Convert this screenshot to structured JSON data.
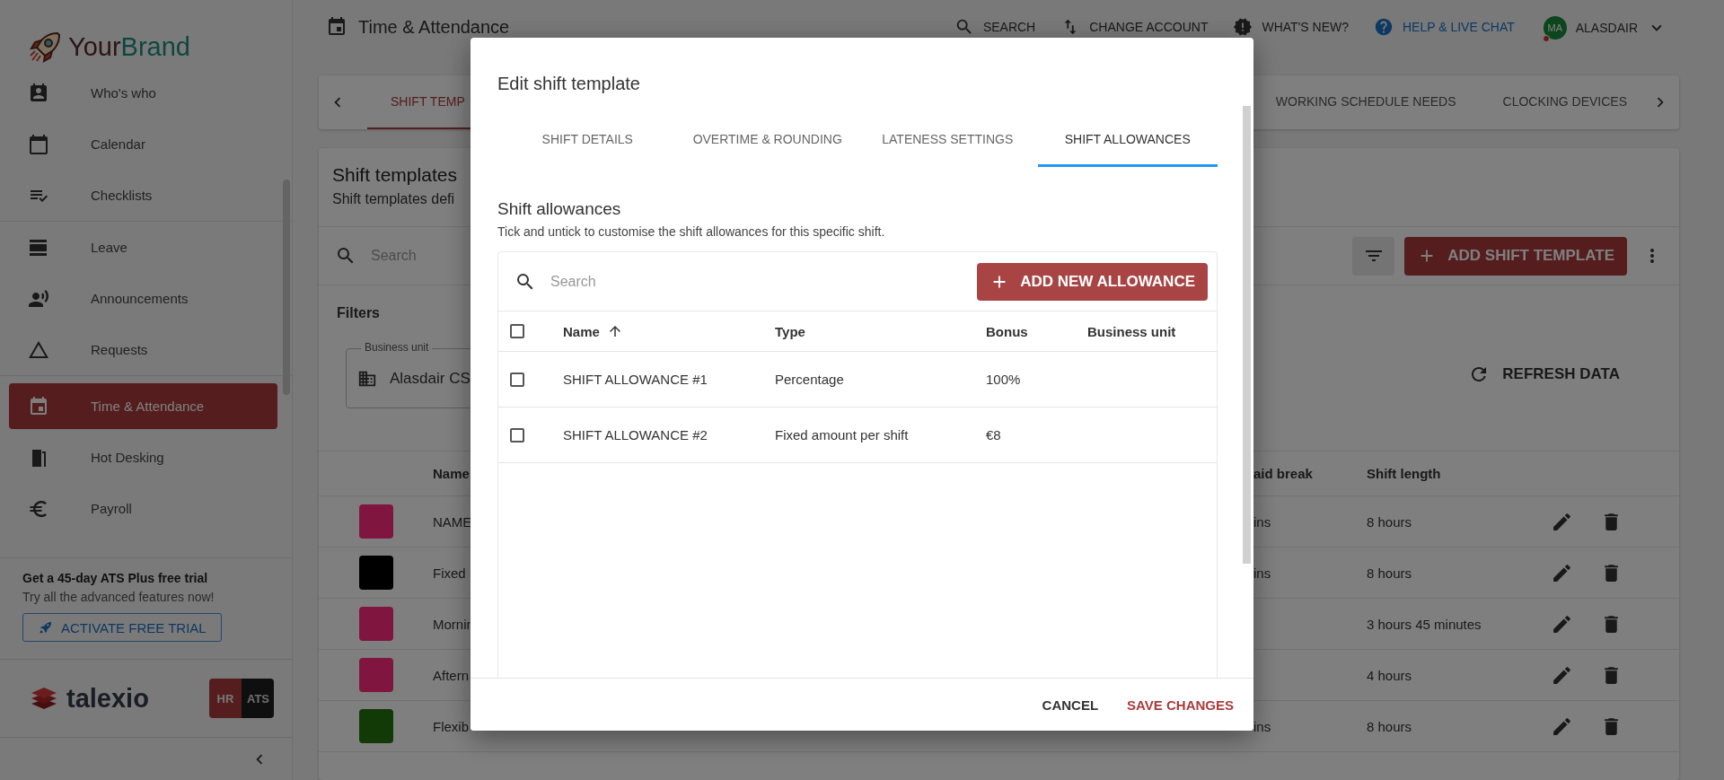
{
  "sidebar": {
    "brand_first": "Your",
    "brand_second": "Brand",
    "groups": [
      [
        {
          "label": "Who's who",
          "selected": false
        },
        {
          "label": "Calendar",
          "selected": false
        },
        {
          "label": "Checklists",
          "selected": false
        }
      ],
      [
        {
          "label": "Leave",
          "selected": false
        },
        {
          "label": "Announcements",
          "selected": false
        },
        {
          "label": "Requests",
          "selected": false
        }
      ],
      [
        {
          "label": "Time & Attendance",
          "selected": true
        },
        {
          "label": "Hot Desking",
          "selected": false
        },
        {
          "label": "Payroll",
          "selected": false
        }
      ]
    ],
    "trial": {
      "title": "Get a 45-day ATS Plus free trial",
      "text": "Try all the advanced features now!",
      "button": "ACTIVATE FREE TRIAL"
    },
    "product_logo": "talexio",
    "switch": [
      {
        "label": "HR",
        "selected": true
      },
      {
        "label": "ATS",
        "selected": false
      }
    ]
  },
  "header": {
    "title": "Time & Attendance",
    "actions": [
      {
        "label": "SEARCH",
        "kind": "search"
      },
      {
        "label": "CHANGE ACCOUNT",
        "kind": "swap"
      },
      {
        "label": "WHAT'S NEW?",
        "kind": "news"
      },
      {
        "label": "HELP & LIVE CHAT",
        "kind": "help"
      }
    ],
    "user": {
      "initials": "MA",
      "name": "ALASDAIR"
    }
  },
  "tabs": [
    {
      "label": "SHIFT TEMP",
      "selected": true
    },
    {
      "label": "WORKING SCHEDULE NEEDS",
      "selected": false
    },
    {
      "label": "CLOCKING DEVICES",
      "selected": false
    }
  ],
  "card": {
    "title": "Shift templates",
    "subtitle": "Shift templates defi",
    "search_placeholder": "Search",
    "add_button": "ADD SHIFT TEMPLATE",
    "filters": "Filters",
    "business_unit": {
      "label": "Business unit",
      "value": "Alasdair CS"
    },
    "refresh": "REFRESH DATA",
    "columns": [
      "Name",
      "aid break",
      "Shift length"
    ],
    "rows": [
      {
        "color": "#801640",
        "name": "NAME",
        "break": "ins",
        "length": "8 hours"
      },
      {
        "color": "#000000",
        "name": "Fixed",
        "break": "ins",
        "length": "8 hours"
      },
      {
        "color": "#801640",
        "name": "Mornin",
        "length": "3 hours 45 minutes"
      },
      {
        "color": "#801640",
        "name": "Aftern",
        "length": "4 hours"
      },
      {
        "color": "#123a06",
        "name": "Flexib",
        "break": "ins",
        "length": "8 hours"
      }
    ]
  },
  "modal": {
    "title": "Edit shift template",
    "tabs": [
      {
        "label": "SHIFT DETAILS",
        "selected": false
      },
      {
        "label": "OVERTIME & ROUNDING",
        "selected": false
      },
      {
        "label": "LATENESS SETTINGS",
        "selected": false
      },
      {
        "label": "SHIFT ALLOWANCES",
        "selected": true
      }
    ],
    "section_title": "Shift allowances",
    "description": "Tick and untick to customise the shift allowances for this specific shift.",
    "search_placeholder": "Search",
    "add_button": "ADD NEW ALLOWANCE",
    "select_all": false,
    "columns": [
      {
        "label": "Name",
        "sorted": true
      },
      {
        "label": "Type",
        "sorted": false
      },
      {
        "label": "Bonus",
        "sorted": false
      },
      {
        "label": "Business unit",
        "sorted": false
      }
    ],
    "rows": [
      {
        "checked": false,
        "name": "SHIFT ALLOWANCE #1",
        "type": "Percentage",
        "bonus": "100%"
      },
      {
        "checked": false,
        "name": "SHIFT ALLOWANCE #2",
        "type": "Fixed amount per shift",
        "bonus": "€8"
      }
    ],
    "buttons": [
      {
        "label": "CANCEL",
        "kind": "secondary"
      },
      {
        "label": "SAVE CHANGES",
        "kind": "primary"
      }
    ]
  }
}
